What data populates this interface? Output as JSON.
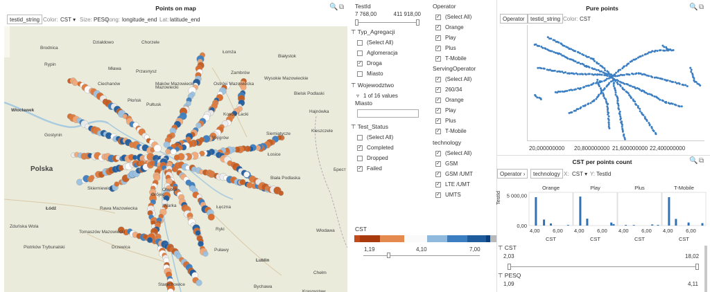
{
  "map_panel": {
    "title": "Points on map",
    "shape_by": "testid_string",
    "color_label": "Color:",
    "color_value": "CST",
    "size_label": "Size:",
    "size_value": "PESQ",
    "long_label": "Long:",
    "long_value": "longitude_end",
    "lat_label": "Lat:",
    "lat_value": "latitude_end"
  },
  "map_labels": [
    {
      "text": "Brodnica"
    },
    {
      "text": "Działdowo"
    },
    {
      "text": "Chorzele"
    },
    {
      "text": "Łomża"
    },
    {
      "text": "Białystok"
    },
    {
      "text": "Rypin"
    },
    {
      "text": "Mława"
    },
    {
      "text": "Przasnysz"
    },
    {
      "text": "Zambrów"
    },
    {
      "text": "Wysokie Mazowieckie"
    },
    {
      "text": "Ciechanów"
    },
    {
      "text": "Maków Mazowiecki"
    },
    {
      "text": "Ostrów Mazowiecka"
    },
    {
      "text": "Bielsk Podlaski"
    },
    {
      "text": "Płońsk"
    },
    {
      "text": "Pułtusk"
    },
    {
      "text": "Kosów Lacki"
    },
    {
      "text": "Hajnówka"
    },
    {
      "text": "Włocławek"
    },
    {
      "text": "Gostynin"
    },
    {
      "text": "Węgrów"
    },
    {
      "text": "Kleszczele"
    },
    {
      "text": "Siemiatycze"
    },
    {
      "text": "Łosice"
    },
    {
      "text": "Polska"
    },
    {
      "text": "Otwock"
    },
    {
      "text": "Брест"
    },
    {
      "text": "Skierniewice"
    },
    {
      "text": "Biała Podlaska"
    },
    {
      "text": "Łódź"
    },
    {
      "text": "Rawa Mazowiecka"
    },
    {
      "text": "Grójec"
    },
    {
      "text": "Warka"
    },
    {
      "text": "Łęczna"
    },
    {
      "text": "Zduńska Wola"
    },
    {
      "text": "Tomaszów Mazowiecki"
    },
    {
      "text": "Ryki"
    },
    {
      "text": "Włodawa"
    },
    {
      "text": "Drzewica"
    },
    {
      "text": "Piotrków Trybunalski"
    },
    {
      "text": "Puławy"
    },
    {
      "text": "Lublin"
    },
    {
      "text": "Chełm"
    },
    {
      "text": "Starachowice"
    },
    {
      "text": "Bychawa"
    },
    {
      "text": "Krasnystaw"
    },
    {
      "text": "Mazowiecki"
    }
  ],
  "filters_a": {
    "testid": {
      "label": "TestId",
      "min": "7 768,00",
      "max": "411 918,00"
    },
    "typ_agregacji": {
      "label": "Typ_Agregacji",
      "items": [
        {
          "label": "(Select All)",
          "checked": false
        },
        {
          "label": "Aglomeracja",
          "checked": false
        },
        {
          "label": "Droga",
          "checked": true
        },
        {
          "label": "Miasto",
          "checked": false
        }
      ]
    },
    "wojewodztwo": {
      "label": "Wojewodztwo",
      "summary": "1 of 16 values"
    },
    "miasto": {
      "label": "Miasto"
    },
    "test_status": {
      "label": "Test_Status",
      "items": [
        {
          "label": "(Select All)",
          "checked": false
        },
        {
          "label": "Completed",
          "checked": true
        },
        {
          "label": "Dropped",
          "checked": false
        },
        {
          "label": "Failed",
          "checked": true
        }
      ]
    }
  },
  "filters_b": {
    "operator": {
      "label": "Operator",
      "items": [
        {
          "label": "(Select All)",
          "checked": true
        },
        {
          "label": "Orange",
          "checked": true
        },
        {
          "label": "Play",
          "checked": true
        },
        {
          "label": "Plus",
          "checked": true
        },
        {
          "label": "T-Mobile",
          "checked": true
        }
      ]
    },
    "serving_operator": {
      "label": "ServingOperator",
      "items": [
        {
          "label": "(Select All)",
          "checked": true
        },
        {
          "label": "260/34",
          "checked": true
        },
        {
          "label": "Orange",
          "checked": true
        },
        {
          "label": "Play",
          "checked": true
        },
        {
          "label": "Plus",
          "checked": true
        },
        {
          "label": "T-Mobile",
          "checked": true
        }
      ]
    },
    "technology": {
      "label": "technology",
      "items": [
        {
          "label": "(Select All)",
          "checked": true
        },
        {
          "label": "GSM",
          "checked": true
        },
        {
          "label": "GSM /UMT",
          "checked": true
        },
        {
          "label": "LTE /UMT",
          "checked": true
        },
        {
          "label": "UMTS",
          "checked": true
        }
      ]
    }
  },
  "cst_legend": {
    "label": "CST",
    "ticks": [
      "1,19",
      "4,10",
      "7,00"
    ],
    "colors": [
      "#c34a1a",
      "#a83a0e",
      "#e58a4e",
      "#fafafa",
      "#8fb9dd",
      "#3b7ec1",
      "#1f5c9e",
      "#0d3f7a",
      "#b9b9b9"
    ]
  },
  "pure_points": {
    "title": "Pure points",
    "operator_chip": "Operator",
    "shape_chip": "testid_string",
    "color_label": "Color:",
    "color_value": "CST",
    "x_ticks": [
      "20,000000000",
      "20,800000000",
      "21,600000000",
      "22,400000000"
    ],
    "point_color": "#3b7ec1"
  },
  "cst_count": {
    "title": "CST per points count",
    "chip1": "Operator",
    "chip2": "technology",
    "x_label": "X:",
    "x_value": "CST",
    "y_label": "Y:",
    "y_value": "TestId",
    "y_axis_title": "TestId",
    "y_ticks": [
      "5 000,00",
      "0,00"
    ],
    "x_ticks": [
      "4,00",
      "6,00"
    ],
    "x_axis_title": "CST",
    "bar_color": "#2e73b8"
  },
  "chart_data": {
    "type": "bar",
    "title": "CST per points count",
    "panels": [
      {
        "name": "Orange",
        "bars": [
          {
            "x": 4.1,
            "y": 4700
          },
          {
            "x": 4.8,
            "y": 1000
          },
          {
            "x": 5.4,
            "y": 350
          },
          {
            "x": 6.9,
            "y": 100
          }
        ]
      },
      {
        "name": "Play",
        "bars": [
          {
            "x": 4.1,
            "y": 4800
          },
          {
            "x": 4.7,
            "y": 1150
          },
          {
            "x": 6.8,
            "y": 500
          },
          {
            "x": 7.0,
            "y": 250
          }
        ]
      },
      {
        "name": "Plus",
        "bars": [
          {
            "x": 4.2,
            "y": 120
          },
          {
            "x": 4.9,
            "y": 100
          },
          {
            "x": 6.5,
            "y": 180
          },
          {
            "x": 7.0,
            "y": 120
          }
        ]
      },
      {
        "name": "T-Mobile",
        "bars": [
          {
            "x": 4.1,
            "y": 4700
          },
          {
            "x": 4.7,
            "y": 1100
          },
          {
            "x": 5.8,
            "y": 500
          },
          {
            "x": 7.0,
            "y": 400
          }
        ]
      }
    ],
    "xlabel": "CST",
    "ylabel": "TestId",
    "ylim": [
      0,
      5500
    ],
    "y_ticks": [
      "5 000,00",
      "0,00"
    ],
    "x_ticks": [
      "4,00",
      "6,00"
    ]
  },
  "bottom_filters": {
    "cst": {
      "label": "CST",
      "min": "2,03",
      "max": "18,02"
    },
    "pesq": {
      "label": "PESQ",
      "min": "1,09",
      "max": "4,11"
    }
  }
}
